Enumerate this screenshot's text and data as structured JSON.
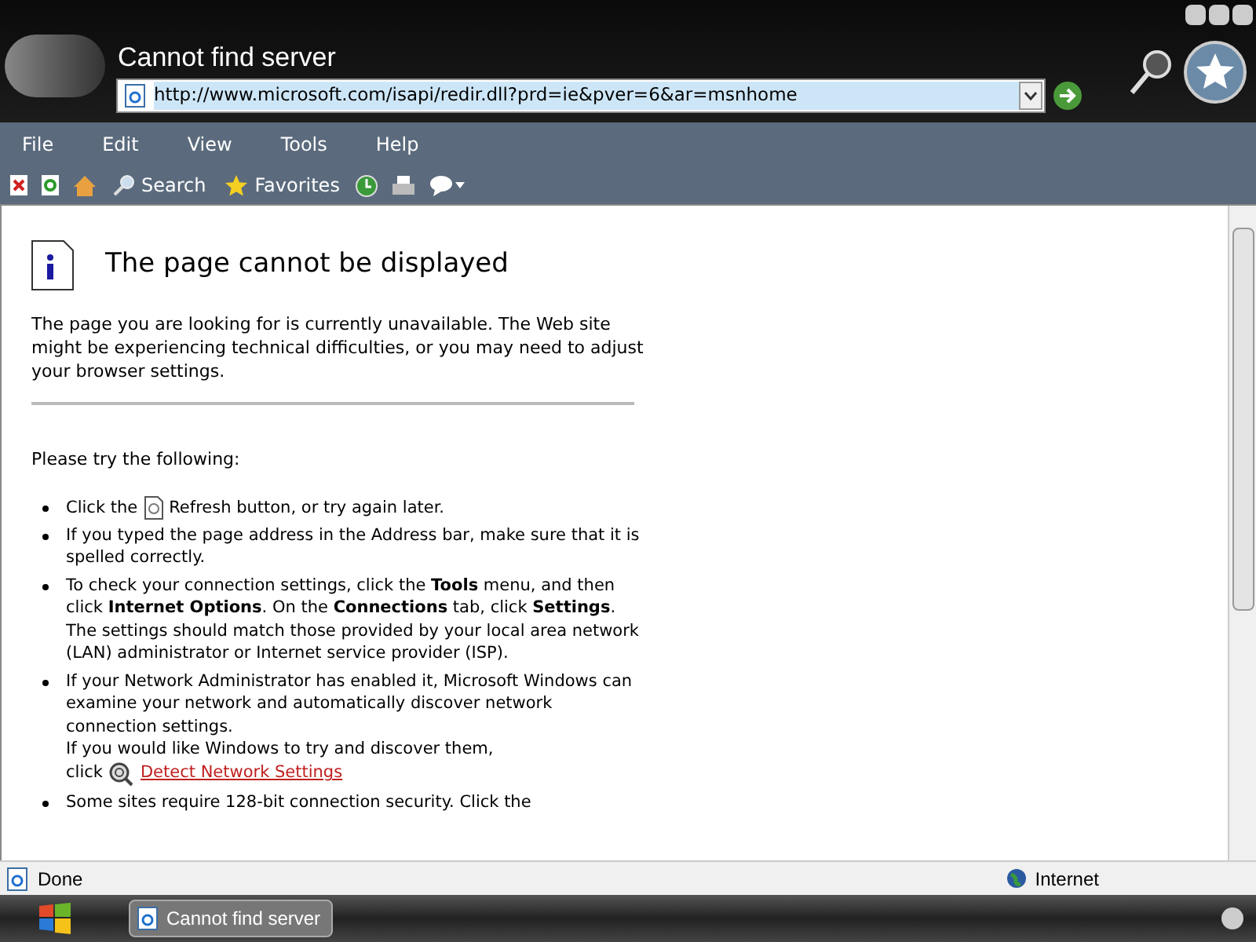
{
  "window": {
    "title": "Cannot find server"
  },
  "address": {
    "value": "http://www.microsoft.com/isapi/redir.dll?prd=ie&pver=6&ar=msnhome"
  },
  "menu": [
    "File",
    "Edit",
    "View",
    "Tools",
    "Help"
  ],
  "toolbar": [
    {
      "kind": "stop"
    },
    {
      "kind": "refresh"
    },
    {
      "kind": "home"
    },
    {
      "kind": "search",
      "label": "Search"
    },
    {
      "kind": "favorites",
      "label": "Favorites"
    },
    {
      "kind": "history"
    },
    {
      "kind": "print"
    },
    {
      "kind": "discuss"
    }
  ],
  "page": {
    "heading": "The page cannot be displayed",
    "intro": "The page you are looking for is currently unavailable. The Web site might be experiencing technical difficulties, or you may need to adjust your browser settings.",
    "try": "Please try the following:",
    "items": [
      {
        "kind": "refresh",
        "before": "Click the",
        "text": "Refresh button, or try again later."
      },
      {
        "kind": "text",
        "text": "If you typed the page address in the Address bar, make sure that it is spelled correctly."
      },
      {
        "kind": "text",
        "text": "To check your connection settings, click the **Tools** menu, and then click **Internet Options**. On the **Connections** tab, click **Settings**. The settings should match those provided by your local area network (LAN) administrator or Internet service provider (ISP)."
      },
      {
        "kind": "detect",
        "text": "If your Network Administrator has enabled it, Microsoft Windows can examine your network and automatically discover network connection settings.",
        "text2": "If you would like Windows to try and discover them,",
        "before": "click",
        "link": "Detect Network Settings"
      },
      {
        "kind": "text",
        "text": "Some sites require 128-bit connection security. Click the"
      }
    ]
  },
  "status_bar": {
    "text": "Done",
    "zone": "Internet"
  },
  "taskbar": {
    "task": "Cannot find server"
  }
}
